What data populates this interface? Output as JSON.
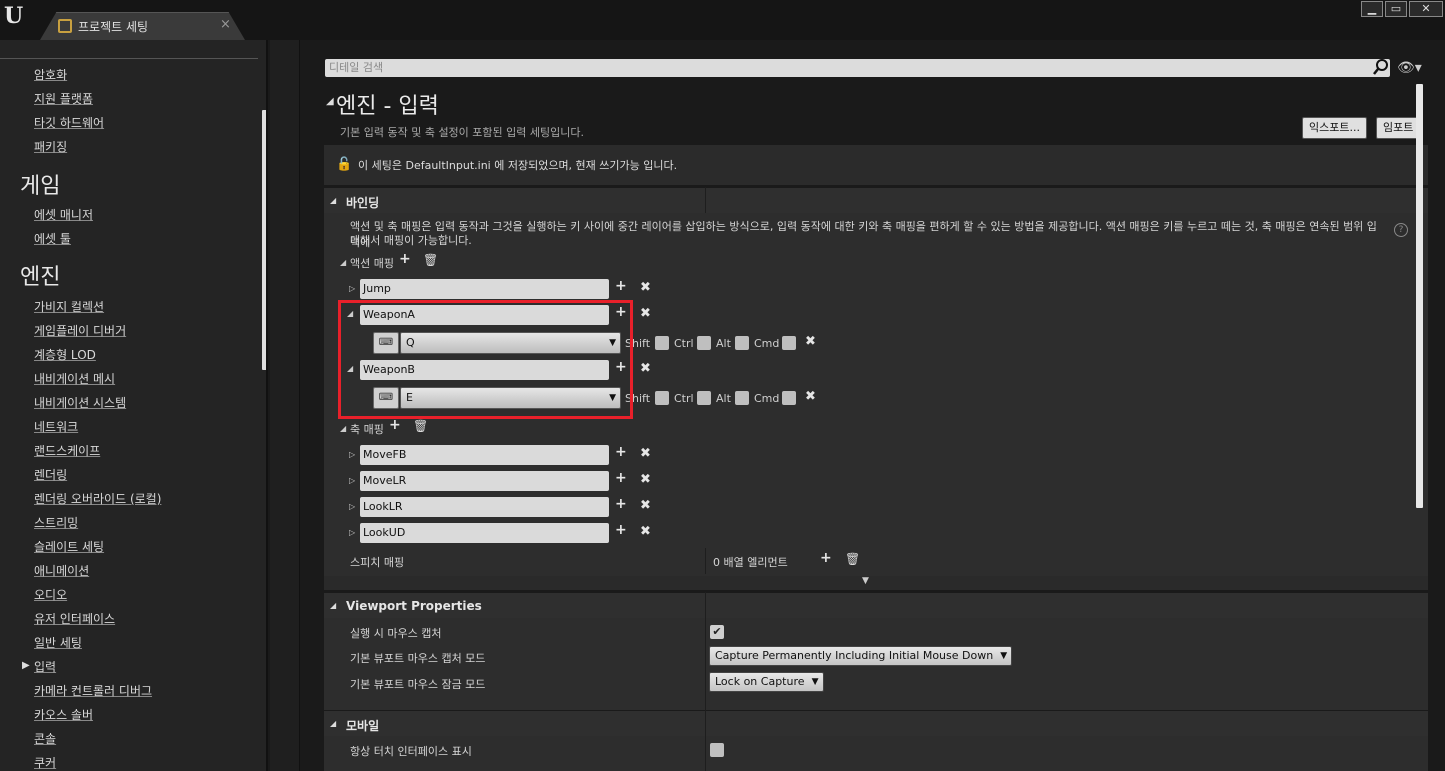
{
  "window": {
    "tab_label": "프로젝트 세팅",
    "tab_close": "×",
    "btn_min": "▁",
    "btn_max": "▭",
    "btn_close": "✕",
    "logo": "U"
  },
  "sidebar": {
    "items_top": [
      "암호화",
      "지원 플랫폼",
      "타깃 하드웨어",
      "패키징"
    ],
    "heading_game": "게임",
    "items_game": [
      "에셋 매니저",
      "에셋 툴"
    ],
    "heading_engine": "엔진",
    "items_engine": [
      "가비지 컬렉션",
      "게임플레이 디버거",
      "계층형 LOD",
      "내비게이션 메시",
      "내비게이션 시스템",
      "네트워크",
      "랜드스케이프",
      "렌더링",
      "렌더링 오버라이드 (로컬)",
      "스트리밍",
      "슬레이트 세팅",
      "애니메이션",
      "오디오",
      "유저 인터페이스",
      "일반 세팅",
      "입력",
      "카메라 컨트롤러 디버그",
      "카오스 솔버",
      "콘솔",
      "쿠커"
    ],
    "selected": "입력"
  },
  "search": {
    "placeholder": "디테일 검색"
  },
  "page": {
    "title": "엔진 - 입력",
    "description": "기본 입력 동작 및 축 설정이 포함된 입력 세팅입니다.",
    "export_label": "익스포트...",
    "import_label": "임포트"
  },
  "notice": {
    "text": "이 세팅은 DefaultInput.ini 에 저장되었으며, 현재 쓰기가능 입니다."
  },
  "bindings": {
    "title": "바인딩",
    "description_line1": "액션 및 축 매핑은 입력 동작과 그것을 실행하는 키 사이에 중간 레이어를 삽입하는 방식으로, 입력 동작에 대한 키와 축 매핑을 편하게 할 수 있는 방법을 제공합니다. 액션 매핑은 키를 누르고 떼는 것, 축 매핑은 연속된 범위 입력에",
    "description_line2": "대해서 매핑이 가능합니다.",
    "action_label": "액션 매핑",
    "actions": [
      {
        "name": "Jump",
        "expanded": false
      },
      {
        "name": "WeaponA",
        "expanded": true,
        "key": "Q"
      },
      {
        "name": "WeaponB",
        "expanded": true,
        "key": "E"
      }
    ],
    "modifiers": [
      "Shift",
      "Ctrl",
      "Alt",
      "Cmd"
    ],
    "axis_label": "축 매핑",
    "axes": [
      "MoveFB",
      "MoveLR",
      "LookLR",
      "LookUD"
    ],
    "speech_label": "스피치 매핑",
    "speech_value": "0 배열 엘리먼트"
  },
  "viewport": {
    "title": "Viewport Properties",
    "capture_on_play_label": "실행 시 마우스 캡처",
    "capture_on_play": true,
    "capture_mode_label": "기본 뷰포트 마우스 캡처 모드",
    "capture_mode_value": "Capture Permanently Including Initial Mouse Down",
    "lock_mode_label": "기본 뷰포트 마우스 잠금 모드",
    "lock_mode_value": "Lock on Capture"
  },
  "mobile": {
    "title": "모바일",
    "touch_label": "항상 터치 인터페이스 표시",
    "touch_checked": false
  },
  "colors": {
    "highlight": "#e8202a",
    "background": "#1a1a1a",
    "panel": "#2d2d2d"
  }
}
